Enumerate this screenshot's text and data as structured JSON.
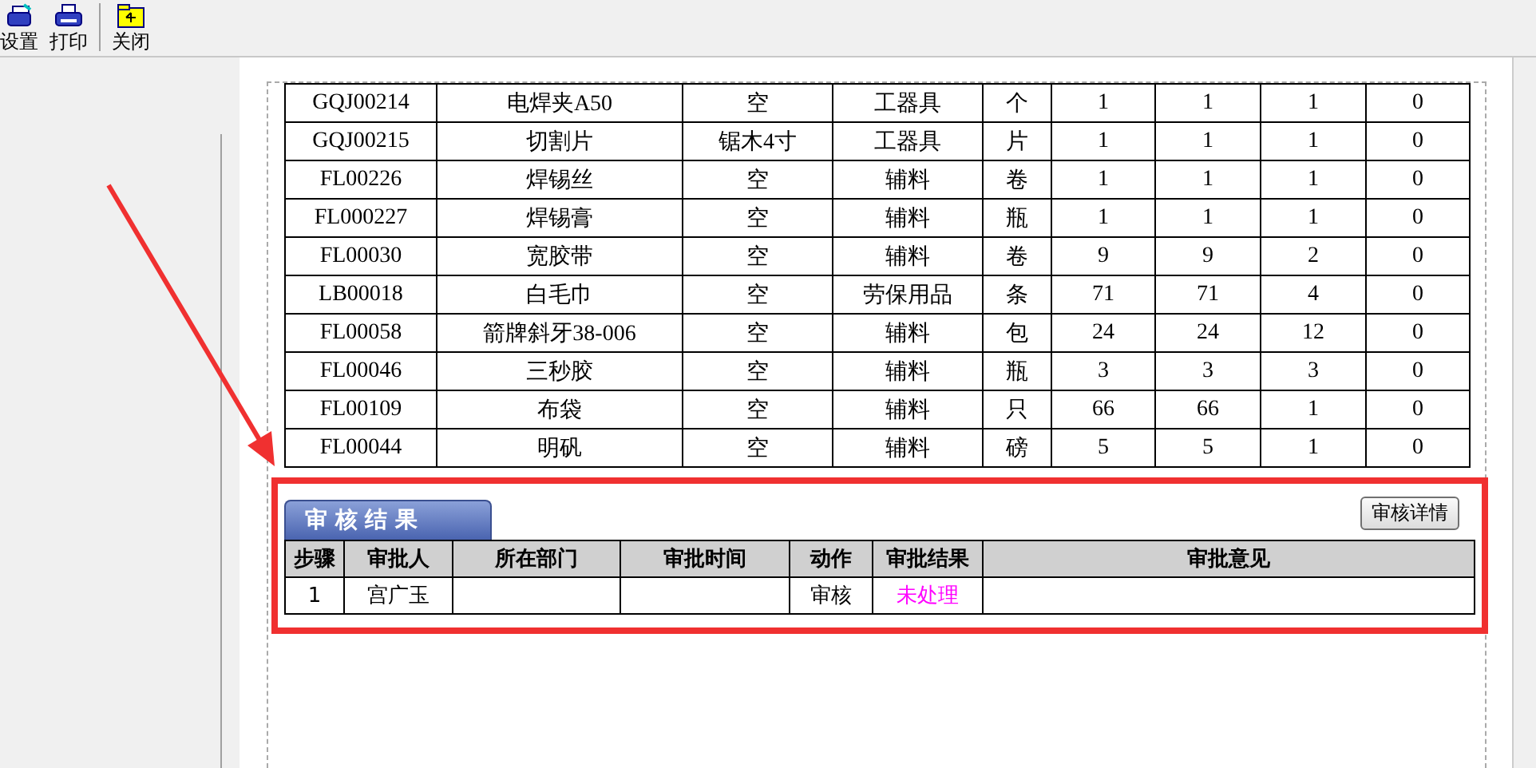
{
  "toolbar": [
    {
      "kind": "setup",
      "label": "设置"
    },
    {
      "kind": "print",
      "label": "打印"
    },
    {
      "kind": "close",
      "label": "关闭"
    }
  ],
  "items": [
    [
      "GQJ00214",
      "电焊夹A50",
      "空",
      "工器具",
      "个",
      "1",
      "1",
      "1",
      "0"
    ],
    [
      "GQJ00215",
      "切割片",
      "锯木4寸",
      "工器具",
      "片",
      "1",
      "1",
      "1",
      "0"
    ],
    [
      "FL00226",
      "焊锡丝",
      "空",
      "辅料",
      "卷",
      "1",
      "1",
      "1",
      "0"
    ],
    [
      "FL000227",
      "焊锡膏",
      "空",
      "辅料",
      "瓶",
      "1",
      "1",
      "1",
      "0"
    ],
    [
      "FL00030",
      "宽胶带",
      "空",
      "辅料",
      "卷",
      "9",
      "9",
      "2",
      "0"
    ],
    [
      "LB00018",
      "白毛巾",
      "空",
      "劳保用品",
      "条",
      "71",
      "71",
      "4",
      "0"
    ],
    [
      "FL00058",
      "箭牌斜牙38-006",
      "空",
      "辅料",
      "包",
      "24",
      "24",
      "12",
      "0"
    ],
    [
      "FL00046",
      "三秒胶",
      "空",
      "辅料",
      "瓶",
      "3",
      "3",
      "3",
      "0"
    ],
    [
      "FL00109",
      "布袋",
      "空",
      "辅料",
      "只",
      "66",
      "66",
      "1",
      "0"
    ],
    [
      "FL00044",
      "明矾",
      "空",
      "辅料",
      "磅",
      "5",
      "5",
      "1",
      "0"
    ]
  ],
  "approval": {
    "tab": "审 核 结 果",
    "details_button": "审核详情",
    "columns": [
      "步骤",
      "审批人",
      "所在部门",
      "审批时间",
      "动作",
      "审批结果",
      "审批意见"
    ],
    "rows": [
      {
        "step": "1",
        "approver": "宫广玉",
        "action": "审核",
        "result": "未处理",
        "pending": true
      }
    ]
  }
}
